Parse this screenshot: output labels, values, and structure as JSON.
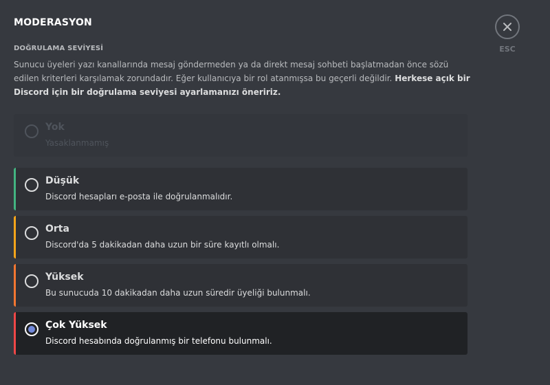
{
  "page": {
    "title": "MODERASYON",
    "section_label": "DOĞRULAMA SEVİYESİ",
    "description_plain": "Sunucu üyeleri yazı kanallarında mesaj göndermeden ya da direkt mesaj sohbeti başlatmadan önce sözü edilen kriterleri karşılamak zorundadır. Eğer kullanıcıya bir rol atanmışsa bu geçerli değildir.",
    "description_bold": "Herkese açık bir Discord için bir doğrulama seviyesi ayarlamanızı öneririz."
  },
  "close": {
    "icon": "close-icon",
    "label": "ESC"
  },
  "levels": [
    {
      "title": "Yok",
      "description": "Yasaklanmamış",
      "accent": "transparent",
      "state": "disabled"
    },
    {
      "title": "Düşük",
      "description": "Discord hesapları e-posta ile doğrulanmalıdır.",
      "accent": "#43b581",
      "state": "default"
    },
    {
      "title": "Orta",
      "description": "Discord'da 5 dakikadan daha uzun bir süre kayıtlı olmalı.",
      "accent": "#faa61a",
      "state": "default"
    },
    {
      "title": "Yüksek",
      "description": "Bu sunucuda 10 dakikadan daha uzun süredir üyeliği bulunmalı.",
      "accent": "#f57731",
      "state": "default"
    },
    {
      "title": "Çok Yüksek",
      "description": "Discord hesabında doğrulanmış bir telefonu bulunmalı.",
      "accent": "#f04747",
      "state": "selected"
    }
  ],
  "colors": {
    "background": "#36393f",
    "option_bg": "#2f3136",
    "selected_bg": "#202225",
    "radio_selected": "#7289da"
  }
}
